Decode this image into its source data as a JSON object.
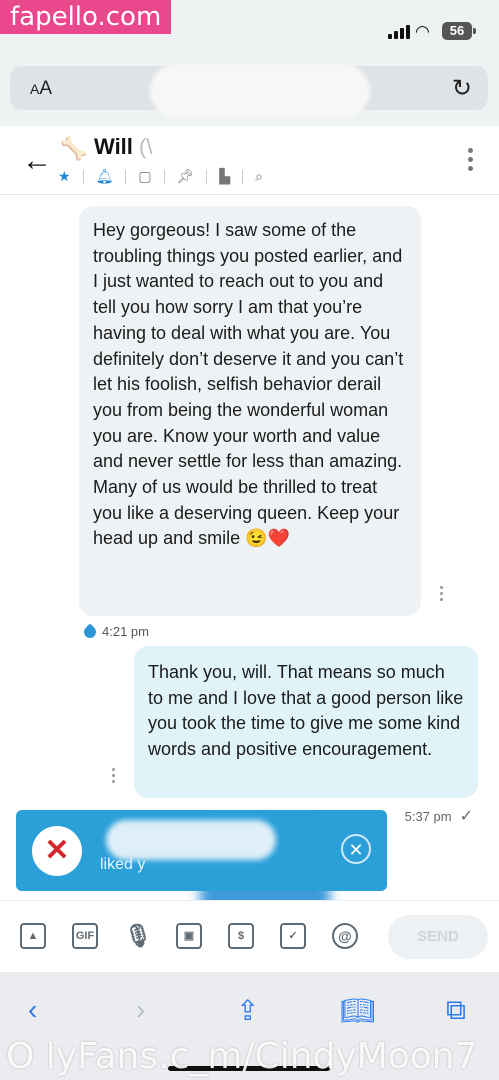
{
  "watermark_top": "fapello.com",
  "watermark_bottom": "O lyFans.c_m/CindyMoon7",
  "status": {
    "battery": "56"
  },
  "browser": {
    "aa_big": "A",
    "aa_small": "A"
  },
  "chat": {
    "contact_name": "Will",
    "contact_name_suffix": "(\\",
    "incoming": {
      "text": "Hey gorgeous! I saw some of the troubling things you posted earlier, and I just wanted to reach out to you and tell you how sorry I am that you’re having to deal with what you are. You definitely don’t deserve it and you can’t let his foolish, selfish behavior derail you from being the wonderful woman you are. Know your worth and value and never settle for less than amazing. Many of us would be thrilled to treat you like a deserving queen. Keep your head up and smile 😉❤️",
      "time": "4:21 pm"
    },
    "outgoing": {
      "text": "Thank you, will. That means so much to me and I love that a good person like you took the time to give me some kind words and positive encouragement.",
      "time": "5:37 pm"
    }
  },
  "toast": {
    "text": "liked y"
  },
  "composer": {
    "send_label": "SEND",
    "gif_label": "GIF"
  }
}
